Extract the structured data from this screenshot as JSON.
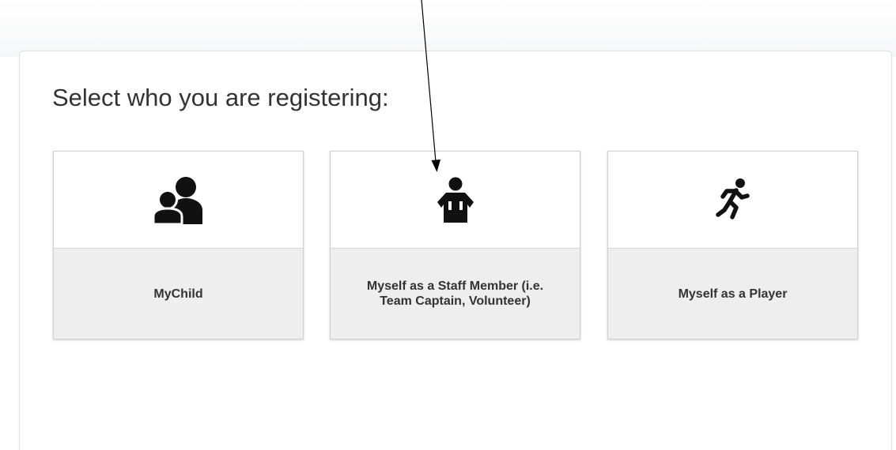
{
  "heading": "Select who you are registering:",
  "options": [
    {
      "label": "MyChild",
      "icon": "parent-child-icon"
    },
    {
      "label": "Myself as a Staff Member (i.e. Team Captain, Volunteer)",
      "icon": "staff-member-icon"
    },
    {
      "label": "Myself as a Player",
      "icon": "runner-icon"
    }
  ]
}
